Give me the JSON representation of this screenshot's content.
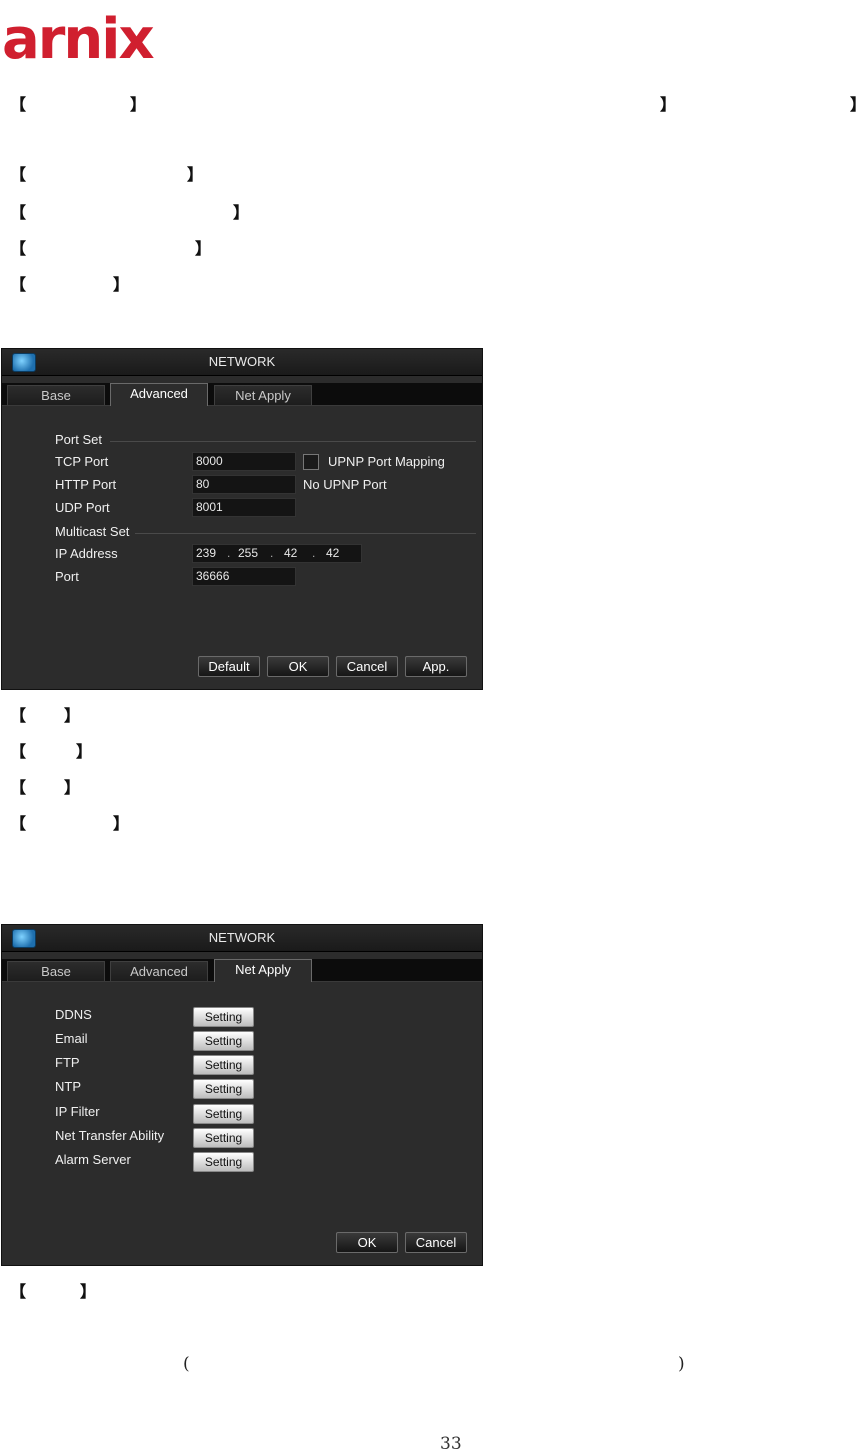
{
  "brand": {
    "logo_text": "arnix",
    "color": "#d01f2f"
  },
  "brackets": {
    "open": "【",
    "close": "】"
  },
  "parens": {
    "open": "(",
    "close": ")"
  },
  "page_number": "33",
  "window1": {
    "title": "NETWORK",
    "tabs": [
      "Base",
      "Advanced",
      "Net Apply"
    ],
    "active_tab": "Advanced",
    "port_set_label": "Port Set",
    "tcp_port_label": "TCP Port",
    "tcp_port_value": "8000",
    "upnp_checkbox_label": "UPNP Port Mapping",
    "upnp_checked": false,
    "http_port_label": "HTTP Port",
    "http_port_value": "80",
    "upnp_status": "No UPNP Port",
    "udp_port_label": "UDP Port",
    "udp_port_value": "8001",
    "multicast_set_label": "Multicast Set",
    "ip_address_label": "IP Address",
    "ip_octets": [
      "239",
      "255",
      "42",
      "42"
    ],
    "ip_dot": ".",
    "port_label": "Port",
    "port_value": "36666",
    "buttons": {
      "default": "Default",
      "ok": "OK",
      "cancel": "Cancel",
      "apply": "App."
    }
  },
  "window2": {
    "title": "NETWORK",
    "tabs": [
      "Base",
      "Advanced",
      "Net Apply"
    ],
    "active_tab": "Net Apply",
    "items": [
      {
        "label": "DDNS",
        "button": "Setting"
      },
      {
        "label": "Email",
        "button": "Setting"
      },
      {
        "label": "FTP",
        "button": "Setting"
      },
      {
        "label": "NTP",
        "button": "Setting"
      },
      {
        "label": "IP Filter",
        "button": "Setting"
      },
      {
        "label": "Net Transfer Ability",
        "button": "Setting"
      },
      {
        "label": "Alarm Server",
        "button": "Setting"
      }
    ],
    "buttons": {
      "ok": "OK",
      "cancel": "Cancel"
    }
  }
}
